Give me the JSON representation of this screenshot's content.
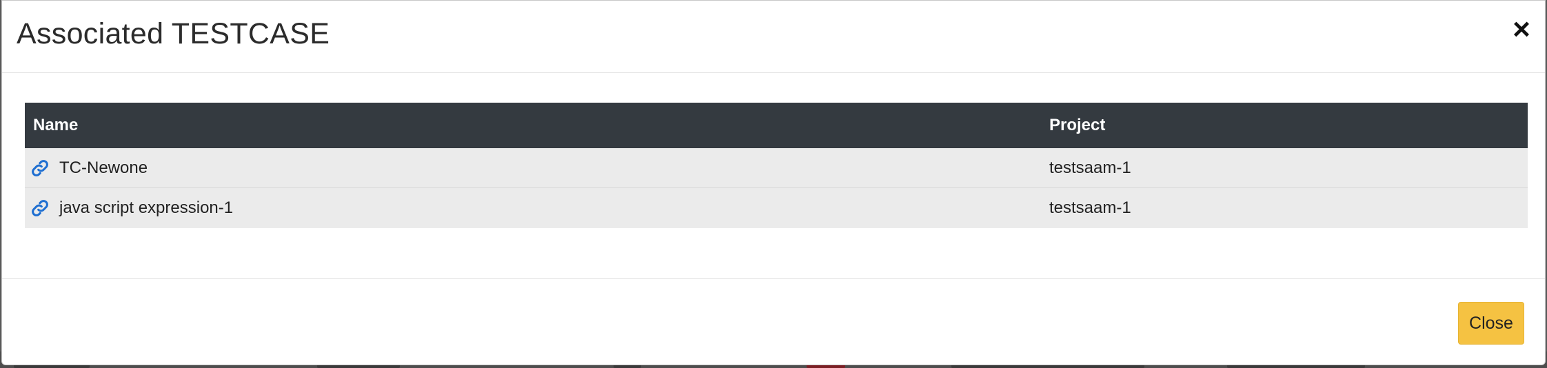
{
  "modal": {
    "title": "Associated TESTCASE",
    "close_icon": "close-icon",
    "close_glyph": "×"
  },
  "table": {
    "headers": {
      "name": "Name",
      "project": "Project"
    },
    "rows": [
      {
        "name": "TC-Newone",
        "project": "testsaam-1",
        "icon": "link-icon"
      },
      {
        "name": "java script expression-1",
        "project": "testsaam-1",
        "icon": "link-icon"
      }
    ]
  },
  "footer": {
    "close_label": "Close"
  },
  "colors": {
    "header_bg": "#343a40",
    "row_bg": "#ebebeb",
    "link_icon": "#1f6fd1",
    "close_button": "#f5c242"
  }
}
